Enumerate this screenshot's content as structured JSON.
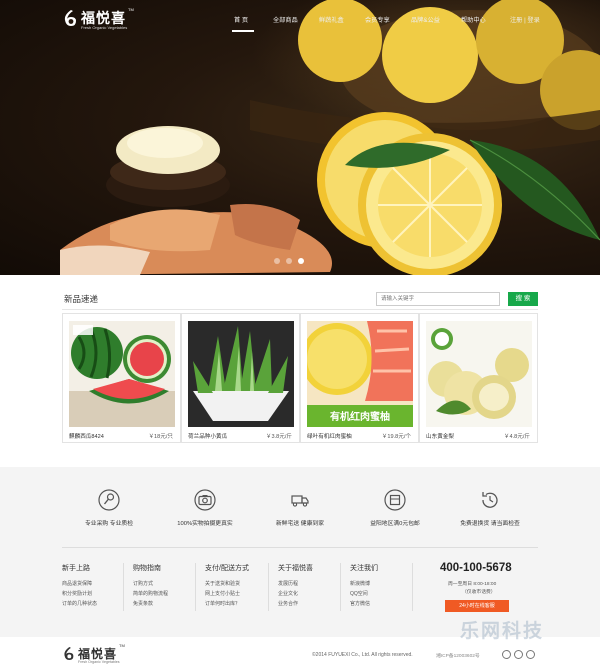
{
  "header": {
    "logo_text": "福悦喜",
    "logo_tm": "TM",
    "logo_subtitle": "Fresh Organic Vegetables",
    "menu": [
      "首 页",
      "全部商品",
      "鲜蔬礼盒",
      "会员专享",
      "品牌&公益",
      "帮助中心"
    ],
    "active_index": 0,
    "auth": "注册 | 登录"
  },
  "carousel": {
    "slides": 3,
    "active": 2
  },
  "new_products": {
    "title": "新品速递",
    "search_placeholder": "请输入关键字",
    "search_button": "搜 索",
    "items": [
      {
        "name": "麒麟西瓜8424",
        "price": "￥18元/只",
        "image": "watermelon"
      },
      {
        "name": "荷兰品种小黄瓜",
        "price": "￥3.8元/斤",
        "image": "cucumber"
      },
      {
        "name": "绿叶有机红肉蜜柚",
        "price": "￥19.8元/个",
        "image": "pomelo",
        "image_caption": "有机红肉蜜柚"
      },
      {
        "name": "山东黄金梨",
        "price": "￥4.8元/斤",
        "image": "pear"
      }
    ]
  },
  "features": [
    {
      "label": "专业采购 专业质检",
      "icon": "quality-icon"
    },
    {
      "label": "100%实物拍摄更真实",
      "icon": "camera-icon"
    },
    {
      "label": "新鲜宅送 健康到家",
      "icon": "truck-icon"
    },
    {
      "label": "益阳地区满0元包邮",
      "icon": "package-icon"
    },
    {
      "label": "免费退换货 请当面检查",
      "icon": "return-icon"
    }
  ],
  "footer_columns": [
    {
      "heading": "新手上路",
      "links": [
        "商品退货保障",
        "积分奖励计划",
        "订单的几种状态"
      ]
    },
    {
      "heading": "购物指南",
      "links": [
        "订购方式",
        "简单的购物流程",
        "免责条款"
      ]
    },
    {
      "heading": "支付/配送方式",
      "links": [
        "关于送货和验货",
        "网上支付小贴士",
        "订单何时出库？"
      ]
    },
    {
      "heading": "关于福悦喜",
      "links": [
        "发展历程",
        "企业文化",
        "业务合作"
      ]
    },
    {
      "heading": "关注我们",
      "links": [
        "新浪微博",
        "QQ空间",
        "官方微信"
      ]
    }
  ],
  "contact": {
    "phone": "400-100-5678",
    "hours": "周一至周日 8:00-18:00",
    "hours_note": "（仅收市话费）",
    "online_button": "24小时在线客服"
  },
  "bottom": {
    "logo_text": "福悦喜",
    "logo_tm": "TM",
    "logo_subtitle": "Fresh Organic Vegetables",
    "copyright": "©2014 FUYUEXI Co., Ltd. All rights reserved.",
    "icp": "湘ICP备12003602号"
  },
  "watermark": "乐网科技",
  "colors": {
    "accent_green": "#17a84a",
    "orange": "#f05a24"
  }
}
